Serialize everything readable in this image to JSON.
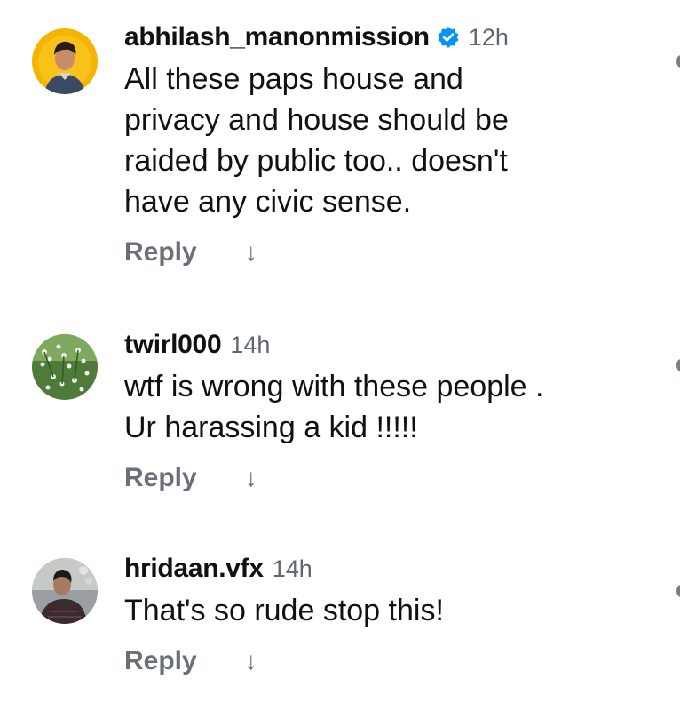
{
  "comments": [
    {
      "username": "abhilash_manonmission",
      "verified": true,
      "time": "12h",
      "text": "All these paps house and\nprivacy and house should be\nraided by public too.. doesn't\nhave any civic sense.",
      "reply_label": "Reply",
      "arrow": "↓",
      "avatar_icon": "profile-photo-man-yellow-background"
    },
    {
      "username": "twirl000",
      "verified": false,
      "time": "14h",
      "text": "wtf is wrong with these people .\nUr harassing a kid !!!!!",
      "reply_label": "Reply",
      "arrow": "↓",
      "avatar_icon": "profile-photo-white-flowers"
    },
    {
      "username": "hridaan.vfx",
      "verified": false,
      "time": "14h",
      "text": "That's so rude stop this!",
      "reply_label": "Reply",
      "arrow": "↓",
      "avatar_icon": "profile-photo-man-dark"
    }
  ],
  "colors": {
    "verified_badge": "#0095f6",
    "muted_text": "#6b7078",
    "primary_text": "#111111"
  }
}
